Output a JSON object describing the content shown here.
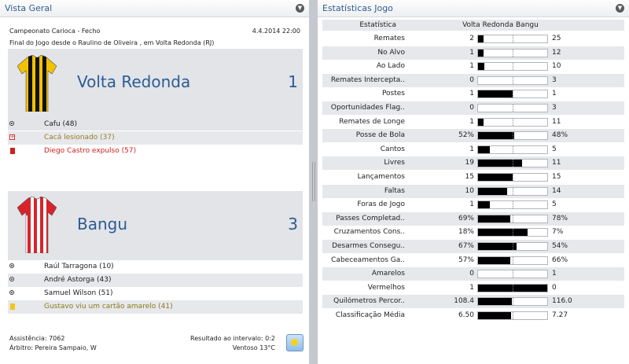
{
  "left_panel": {
    "title": "Vista Geral",
    "competition": "Campeonato Carioca - Fecho",
    "date_time": "4.4.2014 22:00",
    "summary": "Final do Jogo desde o Raulino de Oliveira , em Volta Redonda (RJ)",
    "home": {
      "name": "Volta Redonda",
      "score": "1",
      "shirt_colors": [
        "#f2c200",
        "#111111"
      ],
      "events": [
        {
          "icon": "goal-icon",
          "text": "Cafu (48)",
          "color": "#222222"
        },
        {
          "icon": "injury-icon",
          "text": "Cacá lesionado (37)",
          "color": "#9a7a2a"
        },
        {
          "icon": "red-card-icon",
          "text": "Diego Castro expulso (57)",
          "color": "#d01f1f"
        }
      ]
    },
    "away": {
      "name": "Bangu",
      "score": "3",
      "shirt_colors": [
        "#d9232a",
        "#ffffff"
      ],
      "events": [
        {
          "icon": "goal-icon",
          "text": "Raúl Tarragona (10)",
          "color": "#222222"
        },
        {
          "icon": "goal-icon",
          "text": "André Astorga (43)",
          "color": "#222222"
        },
        {
          "icon": "goal-icon",
          "text": "Samuel Wilson (51)",
          "color": "#222222"
        },
        {
          "icon": "yellow-card-icon",
          "text": "Gustavo viu um cartão amarelo (41)",
          "color": "#8a7a1a"
        }
      ]
    },
    "attendance": "Assistência: 7062",
    "referee": "Árbitro: Pereira Sampaio, W",
    "halftime": "Resultado ao intervalo: 0:2",
    "weather": "Ventoso 13°C"
  },
  "right_panel": {
    "title": "Estatísticas Jogo",
    "header": {
      "stat": "Estatística",
      "home": "Volta Redonda",
      "away": "Bangu"
    },
    "stats": [
      {
        "label": "Remates",
        "home": "2",
        "away": "25",
        "share": 0.074
      },
      {
        "label": "No Alvo",
        "home": "1",
        "away": "12",
        "share": 0.077
      },
      {
        "label": "Ao Lado",
        "home": "1",
        "away": "10",
        "share": 0.091
      },
      {
        "label": "Remates Intercepta..",
        "home": "0",
        "away": "3",
        "share": 0
      },
      {
        "label": "Postes",
        "home": "1",
        "away": "1",
        "share": 0.5
      },
      {
        "label": "Oportunidades Flag..",
        "home": "0",
        "away": "3",
        "share": 0
      },
      {
        "label": "Remates de Longe",
        "home": "1",
        "away": "11",
        "share": 0.083
      },
      {
        "label": "Posse de Bola",
        "home": "52%",
        "away": "48%",
        "share": 0.52
      },
      {
        "label": "Cantos",
        "home": "1",
        "away": "5",
        "share": 0.167
      },
      {
        "label": "Livres",
        "home": "19",
        "away": "11",
        "share": 0.633
      },
      {
        "label": "Lançamentos",
        "home": "15",
        "away": "15",
        "share": 0.5
      },
      {
        "label": "Faltas",
        "home": "10",
        "away": "14",
        "share": 0.417
      },
      {
        "label": "Foras de Jogo",
        "home": "1",
        "away": "5",
        "share": 0.167
      },
      {
        "label": "Passes Completad..",
        "home": "69%",
        "away": "78%",
        "share": 0.469
      },
      {
        "label": "Cruzamentos Cons..",
        "home": "18%",
        "away": "7%",
        "share": 0.72
      },
      {
        "label": "Desarmes Consegu..",
        "home": "67%",
        "away": "54%",
        "share": 0.554
      },
      {
        "label": "Cabeceamentos Ga..",
        "home": "57%",
        "away": "66%",
        "share": 0.463
      },
      {
        "label": "Amarelos",
        "home": "0",
        "away": "1",
        "share": 0
      },
      {
        "label": "Vermelhos",
        "home": "1",
        "away": "0",
        "share": 1
      },
      {
        "label": "Quilómetros Percor..",
        "home": "108.4",
        "away": "116.0",
        "share": 0.483
      },
      {
        "label": "Classificação Média",
        "home": "6.50",
        "away": "7.27",
        "share": 0.472
      }
    ]
  }
}
